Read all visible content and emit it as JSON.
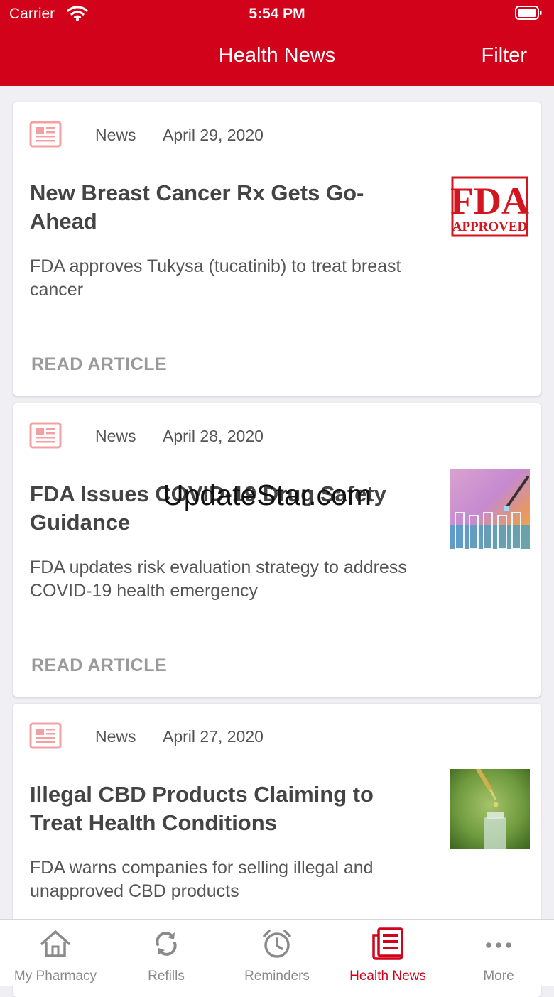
{
  "status_bar": {
    "carrier": "Carrier",
    "time": "5:54 PM"
  },
  "nav": {
    "title": "Health News",
    "filter_label": "Filter"
  },
  "articles": [
    {
      "category": "News",
      "date": "April 29, 2020",
      "title": "New Breast Cancer Rx Gets Go-Ahead",
      "summary": "FDA approves Tukysa (tucatinib) to treat breast cancer",
      "action": "READ ARTICLE",
      "stamp_line1": "FDA",
      "stamp_line2": "APPROVED"
    },
    {
      "category": "News",
      "date": "April 28, 2020",
      "title": "FDA Issues COVID-19 Drug Safety Guidance",
      "summary": "FDA updates risk evaluation strategy to address COVID-19 health emergency",
      "action": "READ ARTICLE"
    },
    {
      "category": "News",
      "date": "April 27, 2020",
      "title": "Illegal CBD Products Claiming to Treat Health Conditions",
      "summary": "FDA warns companies for selling illegal and unapproved CBD products"
    }
  ],
  "watermark": "UpdateStar.com",
  "tabs": [
    {
      "label": "My Pharmacy",
      "icon": "home-icon"
    },
    {
      "label": "Refills",
      "icon": "refresh-icon"
    },
    {
      "label": "Reminders",
      "icon": "alarm-clock-icon"
    },
    {
      "label": "Health News",
      "icon": "newspaper-icon",
      "active": true
    },
    {
      "label": "More",
      "icon": "more-dots-icon"
    }
  ],
  "colors": {
    "brand_red": "#d1021a",
    "tab_inactive": "#8a8a8a",
    "news_icon": "#f4a0a3"
  }
}
